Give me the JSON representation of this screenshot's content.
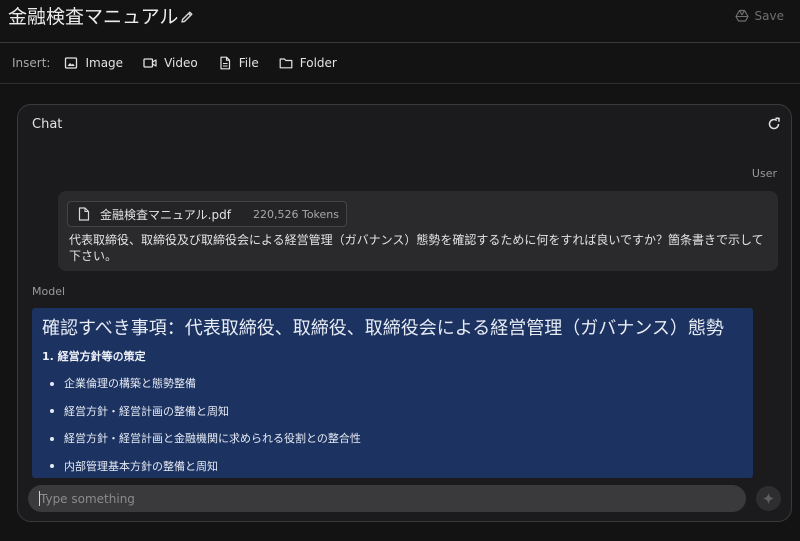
{
  "header": {
    "title": "金融検査マニュアル",
    "save_label": "Save"
  },
  "insert": {
    "label": "Insert:",
    "buttons": [
      "Image",
      "Video",
      "File",
      "Folder"
    ]
  },
  "chat": {
    "title": "Chat",
    "user_label": "User",
    "attachment": {
      "filename": "金融検査マニュアル.pdf",
      "tokens": "220,526 Tokens"
    },
    "user_message": "代表取締役、取締役及び取締役会による経営管理（ガバナンス）態勢を確認するために何をすれば良いですか？箇条書きで示して下さい。",
    "model_label": "Model",
    "model_response": {
      "heading": "確認すべき事項：代表取締役、取締役、取締役会による経営管理（ガバナンス）態勢",
      "section_title": "1. 経営方針等の策定",
      "bullets": [
        "企業倫理の構築と態勢整備",
        "経営方針・経営計画の整備と周知",
        "経営方針・経営計画と金融機関に求められる役割との整合性",
        "内部管理基本方針の整備と周知"
      ]
    },
    "input_placeholder": "Type something"
  },
  "icons": {
    "edit": "pencil-icon",
    "save": "drive-icon",
    "image": "image-icon",
    "video": "video-icon",
    "file": "file-icon",
    "folder": "folder-icon",
    "refresh": "refresh-icon",
    "send": "sparkle-icon"
  }
}
